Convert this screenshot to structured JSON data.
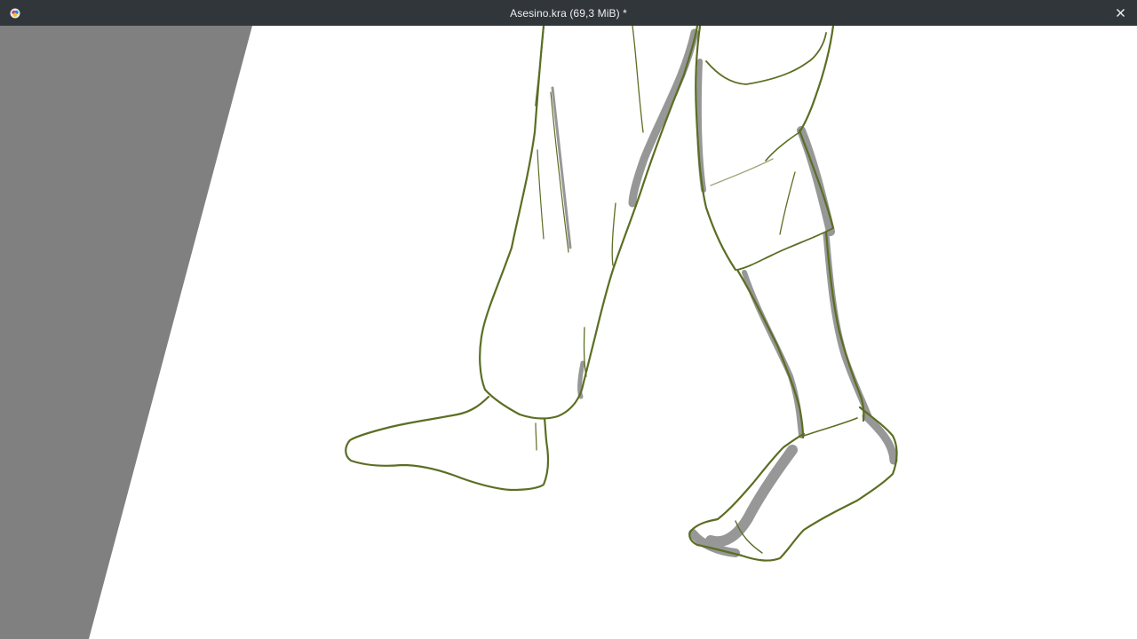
{
  "window": {
    "title": "Asesino.kra (69,3 MiB) *"
  },
  "icons": {
    "app": "krita-app-icon",
    "close": "close-icon"
  },
  "colors": {
    "titlebar_bg": "#31363b",
    "canvas_outside": "#808080",
    "paper": "#ffffff",
    "sketch_line": "#5c6e25",
    "sketch_shade": "#8a8a8a"
  }
}
